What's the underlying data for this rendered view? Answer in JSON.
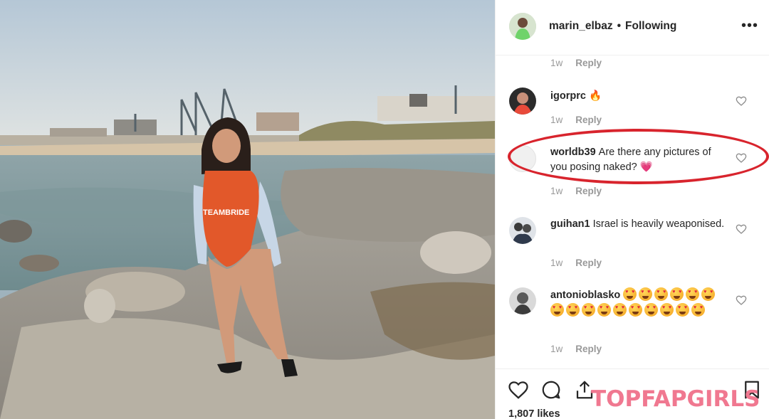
{
  "post": {
    "username": "marin_elbaz",
    "separator": "•",
    "follow_status": "Following",
    "more_label": "•••",
    "swimsuit_text": "TEAMBRIDE"
  },
  "top_meta": {
    "time": "1w",
    "reply": "Reply"
  },
  "comments": [
    {
      "user": "igorprc",
      "text": "🔥",
      "time": "1w",
      "reply": "Reply"
    },
    {
      "user": "worldb39",
      "text": "Are there any pictures of you posing naked? 💗",
      "time": "1w",
      "reply": "Reply"
    },
    {
      "user": "guihan1",
      "text": "Israel is heavily weaponised.",
      "time": "1w",
      "reply": "Reply"
    },
    {
      "user": "antonioblasko",
      "text": "",
      "emoji_count": 16,
      "emoji_name": "heart-eyes-emoji",
      "time": "1w",
      "reply": "Reply"
    }
  ],
  "actions": {
    "likes": "1,807 likes"
  },
  "watermark": "TOPFAPGIRLS",
  "colors": {
    "highlight_ring": "#d8242d",
    "watermark": "#f07890",
    "text": "#262626",
    "muted": "#999999"
  }
}
